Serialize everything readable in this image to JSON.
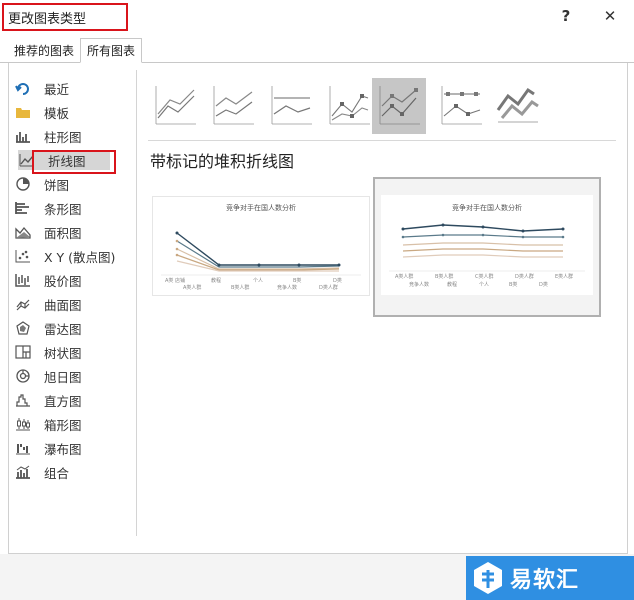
{
  "dialog": {
    "title": "更改图表类型",
    "help": "?",
    "close": "✕"
  },
  "tabs": [
    {
      "label": "推荐的图表"
    },
    {
      "label": "所有图表"
    }
  ],
  "sidebar": {
    "items": [
      {
        "label": "最近",
        "icon": "recent-icon"
      },
      {
        "label": "模板",
        "icon": "folder-icon"
      },
      {
        "label": "柱形图",
        "icon": "column-chart-icon"
      },
      {
        "label": "折线图",
        "icon": "line-chart-icon"
      },
      {
        "label": "饼图",
        "icon": "pie-chart-icon"
      },
      {
        "label": "条形图",
        "icon": "bar-chart-icon"
      },
      {
        "label": "面积图",
        "icon": "area-chart-icon"
      },
      {
        "label": "X Y (散点图)",
        "icon": "scatter-chart-icon"
      },
      {
        "label": "股价图",
        "icon": "stock-chart-icon"
      },
      {
        "label": "曲面图",
        "icon": "surface-chart-icon"
      },
      {
        "label": "雷达图",
        "icon": "radar-chart-icon"
      },
      {
        "label": "树状图",
        "icon": "treemap-chart-icon"
      },
      {
        "label": "旭日图",
        "icon": "sunburst-chart-icon"
      },
      {
        "label": "直方图",
        "icon": "histogram-chart-icon"
      },
      {
        "label": "箱形图",
        "icon": "box-whisker-chart-icon"
      },
      {
        "label": "瀑布图",
        "icon": "waterfall-chart-icon"
      },
      {
        "label": "组合",
        "icon": "combo-chart-icon"
      }
    ],
    "selected": "折线图"
  },
  "subtypes": {
    "icons": [
      "line-icon",
      "stacked-line-icon",
      "percent-stacked-line-icon",
      "line-markers-icon",
      "stacked-line-markers-icon",
      "percent-stacked-line-markers-icon",
      "3d-line-icon"
    ],
    "selected_index": 4,
    "selected_title": "带标记的堆积折线图"
  },
  "previews": [
    {
      "title": "竞争对手在国人数分析",
      "x_ticks": [
        "A类 店铺",
        "教程",
        "个人",
        "B类",
        "D类"
      ],
      "legend": [
        "A类人群",
        "B类人群",
        "竞争人数",
        "D类人群"
      ]
    },
    {
      "title": "竞争对手在国人数分析",
      "x_ticks": [
        "A类人群",
        "B类人群",
        "C类人群",
        "D类人群",
        "E类人群"
      ],
      "legend": [
        "竞争人数",
        "教程",
        "个人",
        "B类",
        "D类"
      ]
    }
  ],
  "watermark": {
    "text": "易软汇"
  },
  "colors": {
    "accent_red": "#d9141b",
    "selected_bg": "#d6d6d6",
    "series_dark": "#2e4a5f",
    "series_mid": "#5a7a8a",
    "series_tan": "#c9a882",
    "series_beige": "#d8c0a8",
    "series_light": "#e0ccbb",
    "watermark_blue": "#2f8fe2"
  }
}
